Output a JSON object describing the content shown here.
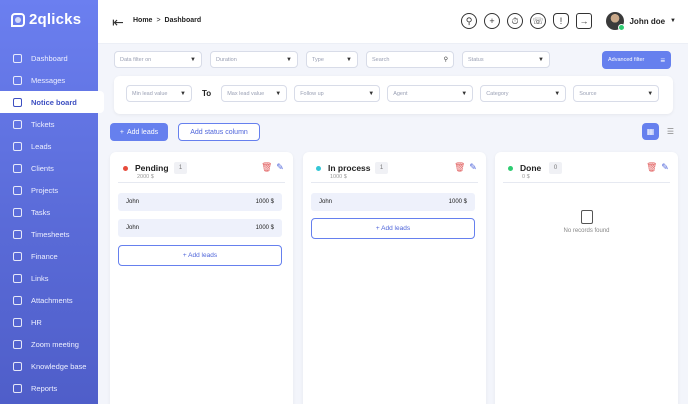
{
  "app": {
    "logo_text": "2qlicks"
  },
  "sidebar": {
    "items": [
      {
        "label": "Dashboard",
        "icon": "home-icon"
      },
      {
        "label": "Messages",
        "icon": "chat-icon"
      },
      {
        "label": "Notice board",
        "icon": "board-icon",
        "active": true
      },
      {
        "label": "Tickets",
        "icon": "ticket-icon"
      },
      {
        "label": "Leads",
        "icon": "leads-icon"
      },
      {
        "label": "Clients",
        "icon": "clients-icon"
      },
      {
        "label": "Projects",
        "icon": "projects-icon"
      },
      {
        "label": "Tasks",
        "icon": "tasks-icon"
      },
      {
        "label": "Timesheets",
        "icon": "clock-icon"
      },
      {
        "label": "Finance",
        "icon": "dollar-icon"
      },
      {
        "label": "Links",
        "icon": "link-icon"
      },
      {
        "label": "Attachments",
        "icon": "attachment-icon"
      },
      {
        "label": "HR",
        "icon": "hr-icon"
      },
      {
        "label": "Zoom meeting",
        "icon": "video-icon"
      },
      {
        "label": "Knowledge base",
        "icon": "book-icon"
      },
      {
        "label": "Reports",
        "icon": "reports-icon"
      }
    ]
  },
  "topbar": {
    "breadcrumb": {
      "home": "Home",
      "separator": ">",
      "current": "Dashboard"
    },
    "user_name": "John doe"
  },
  "filters": {
    "data_filter_placeholder": "Data filter on",
    "duration_placeholder": "Duration",
    "type_placeholder": "Type",
    "search_placeholder": "Search",
    "status_placeholder": "Status",
    "advanced_filter_label": "Advanced filter",
    "min_lead_value": "Min lead value",
    "to_label": "To",
    "max_lead_value": "Max lead value",
    "follow_up": "Follow up",
    "agent": "Agent",
    "category": "Category",
    "source": "Source"
  },
  "actions": {
    "add_leads_label": "Add leads",
    "add_status_column_label": "Add status column"
  },
  "board": {
    "columns": [
      {
        "title": "Pending",
        "subtotal": "2000 $",
        "count": "1",
        "dot_color": "#e74c3c",
        "cards": [
          {
            "name": "John",
            "value": "1000 $"
          },
          {
            "name": "John",
            "value": "1000 $"
          }
        ],
        "add_label": "+ Add leads"
      },
      {
        "title": "In process",
        "subtotal": "1000 $",
        "count": "1",
        "dot_color": "#35c6d6",
        "cards": [
          {
            "name": "John",
            "value": "1000 $"
          }
        ],
        "add_label": "+ Add leads"
      },
      {
        "title": "Done",
        "subtotal": "0 $",
        "count": "0",
        "dot_color": "#2ecc71",
        "cards": [],
        "empty_text": "No records found"
      }
    ]
  },
  "colors": {
    "accent": "#6680ee",
    "sidebar": "#5a6bd8",
    "danger": "#e05a5a"
  }
}
